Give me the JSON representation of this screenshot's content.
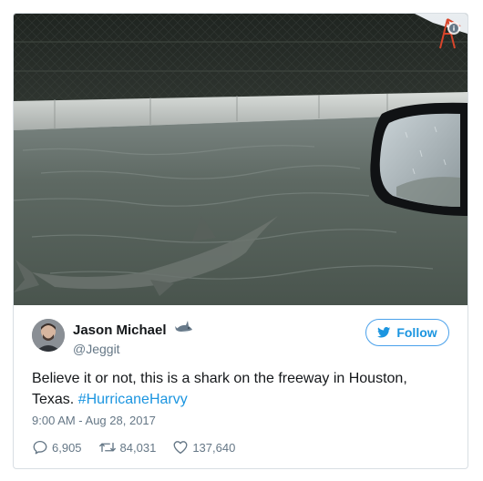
{
  "author": {
    "display_name": "Jason Michael",
    "handle": "@Jeggit",
    "name_emoji": "shark-emoji"
  },
  "follow_button": {
    "label": "Follow",
    "icon": "twitter-bird-icon"
  },
  "tweet": {
    "text_before_hashtag": "Believe it or not, this is a shark on the freeway in Houston, Texas. ",
    "hashtag": "#HurricaneHarvy",
    "timestamp": "9:00 AM - Aug 28, 2017"
  },
  "stats": {
    "replies": "6,905",
    "retweets": "84,031",
    "likes": "137,640"
  },
  "icons": {
    "info": "info-icon",
    "reply": "reply-icon",
    "retweet": "retweet-icon",
    "like": "heart-icon"
  },
  "colors": {
    "link": "#1b95e0",
    "secondary_text": "#657786",
    "primary_text": "#14171a",
    "card_border": "#d8dee3"
  }
}
